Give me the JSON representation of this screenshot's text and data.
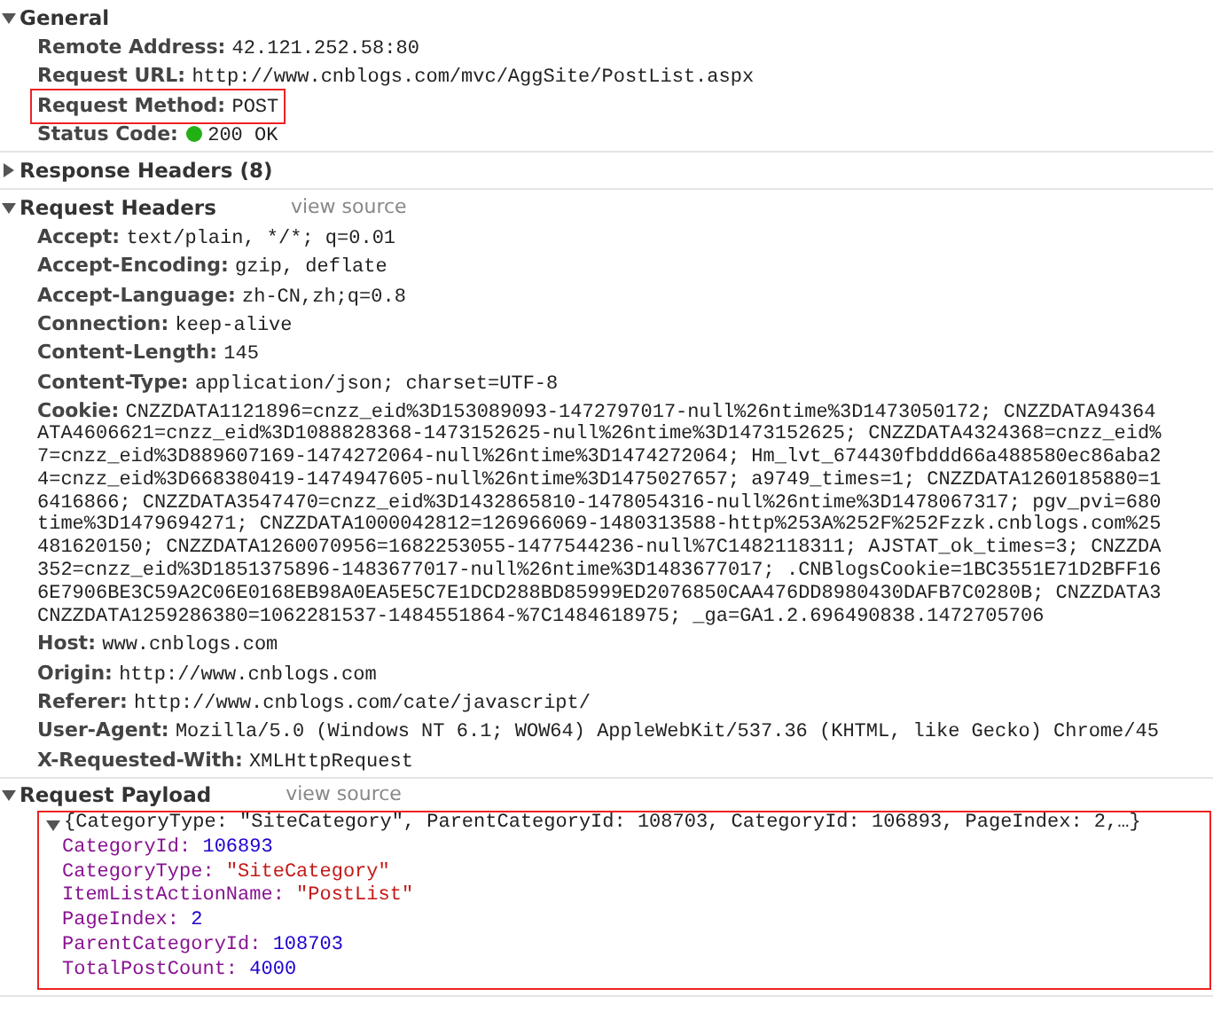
{
  "sections": [
    {
      "title": "General",
      "expanded": true,
      "items": [
        {
          "name": "Remote Address:",
          "value": "42.121.252.58:80",
          "highlighted": false
        },
        {
          "name": "Request URL:",
          "value": "http://www.cnblogs.com/mvc/AggSite/PostList.aspx",
          "highlighted": false
        },
        {
          "name": "Request Method:",
          "value": "POST",
          "highlighted": true
        },
        {
          "name": "Status Code:",
          "value": "200 OK",
          "highlighted": false,
          "color": "#22b014"
        }
      ]
    },
    {
      "title": "Response Headers (8)",
      "expanded": false
    },
    {
      "title": "Request Headers",
      "expanded": true,
      "link": "view source",
      "items": [
        {
          "name": "Accept:",
          "value": "text/plain, */*; q=0.01",
          "highlighted": false
        },
        {
          "name": "Accept-Encoding:",
          "value": "gzip, deflate",
          "highlighted": false
        },
        {
          "name": "Accept-Language:",
          "value": "zh-CN,zh;q=0.8",
          "highlighted": false
        },
        {
          "name": "Connection:",
          "value": "keep-alive",
          "highlighted": false
        },
        {
          "name": "Content-Length:",
          "value": "145",
          "highlighted": false
        },
        {
          "name": "Content-Type:",
          "value": "application/json; charset=UTF-8",
          "highlighted": false
        },
        {
          "name": "Cookie:",
          "value": "CNZZDATA1121896=cnzz_eid%3D153089093-1472797017-null%26ntime%3D1473050172; CNZZDATA94364",
          "highlighted": false,
          "continuation": [
            "ATA4606621=cnzz_eid%3D1088828368-1473152625-null%26ntime%3D1473152625; CNZZDATA4324368=cnzz_eid%",
            "7=cnzz_eid%3D889607169-1474272064-null%26ntime%3D1474272064; Hm_lvt_674430fbddd66a488580ec86aba2",
            "4=cnzz_eid%3D668380419-1474947605-null%26ntime%3D1475027657; a9749_times=1; CNZZDATA1260185880=1",
            "6416866; CNZZDATA3547470=cnzz_eid%3D1432865810-1478054316-null%26ntime%3D1478067317; pgv_pvi=680",
            "time%3D1479694271; CNZZDATA1000042812=126966069-1480313588-http%253A%252F%252Fzzk.cnblogs.com%25",
            "481620150; CNZZDATA1260070956=1682253055-1477544236-null%7C1482118311; AJSTAT_ok_times=3; CNZZDA",
            "352=cnzz_eid%3D1851375896-1483677017-null%26ntime%3D1483677017; .CNBlogsCookie=1BC3551E71D2BFF16",
            "6E7906BE3C59A2C06E0168EB98A0EA5E5C7E1DCD288BD85999ED2076850CAA476DD8980430DAFB7C0280B; CNZZDATA3",
            "CNZZDATA1259286380=1062281537-1484551864-%7C1484618975; _ga=GA1.2.696490838.1472705706"
          ]
        },
        {
          "name": "Host:",
          "value": "www.cnblogs.com",
          "highlighted": false
        },
        {
          "name": "Origin:",
          "value": "http://www.cnblogs.com",
          "highlighted": false
        },
        {
          "name": "Referer:",
          "value": "http://www.cnblogs.com/cate/javascript/",
          "highlighted": false
        },
        {
          "name": "User-Agent:",
          "value": "Mozilla/5.0 (Windows NT 6.1; WOW64) AppleWebKit/537.36 (KHTML, like Gecko) Chrome/45",
          "highlighted": false
        },
        {
          "name": "X-Requested-With:",
          "value": "XMLHttpRequest",
          "highlighted": false
        }
      ]
    },
    {
      "title": "Request Payload",
      "expanded": true,
      "link": "view source",
      "payload": {
        "highlighted": true,
        "expanded": true,
        "summary": "{CategoryType: \"SiteCategory\", ParentCategoryId: 108703, CategoryId: 106893, PageIndex: 2,…}",
        "properties": [
          {
            "key": "CategoryId:",
            "value": "106893",
            "kind": "number"
          },
          {
            "key": "CategoryType:",
            "value": "\"SiteCategory\"",
            "kind": "string"
          },
          {
            "key": "ItemListActionName:",
            "value": "\"PostList\"",
            "kind": "string"
          },
          {
            "key": "PageIndex:",
            "value": "2",
            "kind": "number"
          },
          {
            "key": "ParentCategoryId:",
            "value": "108703",
            "kind": "number"
          },
          {
            "key": "TotalPostCount:",
            "value": "4000",
            "kind": "number"
          }
        ]
      }
    }
  ]
}
